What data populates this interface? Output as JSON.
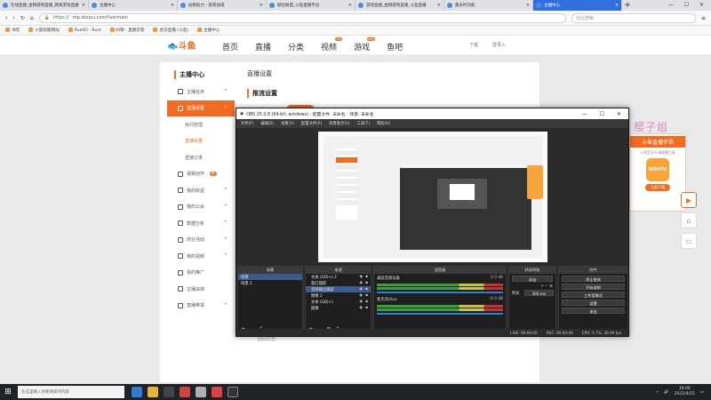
{
  "browser": {
    "tabs": [
      {
        "label": "在线直播_金狮游戏直播_网易游戏直播",
        "active": false
      },
      {
        "label": "主播中心",
        "active": false
      },
      {
        "label": "帖税助力 - 斯宾加琪",
        "active": false
      },
      {
        "label": "赫拉联盟_斗鱼直播平台",
        "active": false
      },
      {
        "label": "游戏直播_金狮游戏直播_斗鱼直播",
        "active": false
      },
      {
        "label": "集米时功能",
        "active": false
      },
      {
        "label": "主播中心",
        "active": true
      }
    ],
    "url_scheme": "https://",
    "url_path": "mp.douyu.com/live/main",
    "search_placeholder": "在此搜索",
    "bookmarks": [
      "书签",
      "火狐优酷网站",
      "RustIO - Rust",
      "抖聊 · 直播云管",
      "虎牙直播 (斗鱼)",
      "主播中心"
    ]
  },
  "site": {
    "logo": "斗鱼",
    "nav": [
      "首页",
      "直播",
      "分类",
      "视频",
      "游戏",
      "鱼吧"
    ],
    "nav_badges": {
      "视频": "hot",
      "游戏": "new"
    },
    "user_items": [
      "下载",
      "登录入"
    ]
  },
  "sidebar": {
    "title": "主播中心",
    "items": [
      {
        "label": "主播任务",
        "type": "item",
        "arrow": "^"
      },
      {
        "label": "直播设置",
        "type": "item",
        "active": true,
        "arrow": "^"
      },
      {
        "label": "房间管理",
        "type": "sub"
      },
      {
        "label": "直播设置",
        "type": "sub",
        "current": true
      },
      {
        "label": "直播记录",
        "type": "sub"
      },
      {
        "label": "视频创作",
        "type": "item",
        "hot": "新"
      },
      {
        "label": "我的收益",
        "type": "item",
        "arrow": "^"
      },
      {
        "label": "我的公会",
        "type": "item",
        "arrow": "^"
      },
      {
        "label": "数据分析",
        "type": "item",
        "arrow": "^"
      },
      {
        "label": "商业活动",
        "type": "item",
        "arrow": "^"
      },
      {
        "label": "我的视频",
        "type": "item",
        "arrow": "^"
      },
      {
        "label": "我的推广",
        "type": "item"
      },
      {
        "label": "主播扶持",
        "type": "item"
      },
      {
        "label": "直播带货",
        "type": "item",
        "arrow": "^"
      }
    ]
  },
  "main": {
    "title": "直播设置",
    "section": "推流设置",
    "bottom_note": "团间公告:"
  },
  "overlay": {
    "danmu": "上周榜一，樱子姐",
    "promo_title": "斗鱼直播伴侣",
    "promo_sub": "斗鱼官方PC端直播工具",
    "promo_app": "DOUYU",
    "promo_button": "立即下载"
  },
  "obs": {
    "title": "OBS 25.0.8 (64-bit, windows) - 配置文件: 未命名 - 场景: 未命名",
    "menu": [
      "文件(F)",
      "编辑(E)",
      "查看(V)",
      "配置文件(P)",
      "场景集合(S)",
      "工具(T)",
      "帮助(H)"
    ],
    "scenes_header": "场景",
    "scenes": [
      "场景",
      "场景 2"
    ],
    "sources_header": "来源",
    "sources": [
      "文本 (GDI+) 2",
      "窗口捕获",
      "音频输出捕获",
      "图像 2",
      "文本 (GDI+)",
      "图像"
    ],
    "mixer_header": "混音器",
    "mixer": [
      {
        "name": "桌面音频设备",
        "db": "0.0 dB"
      },
      {
        "name": "麦克风/Aux",
        "db": "-6.0 dB"
      }
    ],
    "transitions_header": "转场特效",
    "transition_type": "淡出",
    "duration_label": "时长",
    "duration_value": "300 ms",
    "controls_header": "控件",
    "controls": [
      "停止推流",
      "开始录制",
      "工作室模式",
      "设置",
      "退出"
    ],
    "status": {
      "live": "LIVE: 00:00:00",
      "rec": "REC: 00:00:00",
      "cpu": "CPU: 5.7%, 30.00 fps"
    }
  },
  "taskbar": {
    "search_placeholder": "在这里输入你要搜索的内容",
    "time": "19:09",
    "date": "2022/4/25"
  }
}
